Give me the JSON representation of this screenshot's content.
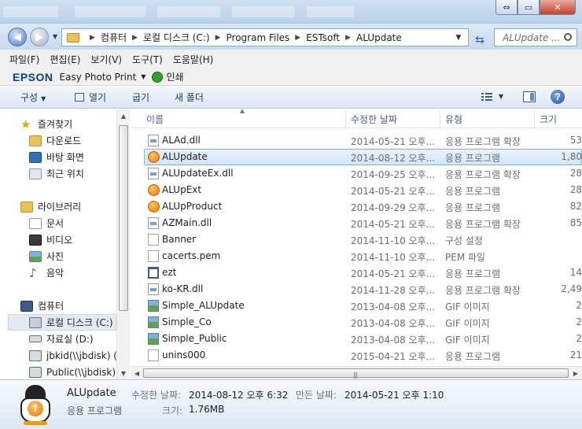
{
  "address": {
    "crumbs": [
      "컴퓨터",
      "로컬 디스크 (C:)",
      "Program Files",
      "ESTsoft",
      "ALUpdate"
    ]
  },
  "search": {
    "placeholder": "ALUpdate ..."
  },
  "menu": [
    "파일(F)",
    "편집(E)",
    "보기(V)",
    "도구(T)",
    "도움말(H)"
  ],
  "epson": {
    "logo": "EPSON",
    "app": "Easy Photo Print",
    "print": "인쇄"
  },
  "command": {
    "organize": "구성",
    "open": "열기",
    "burn": "굽기",
    "new_folder": "새 폴더"
  },
  "nav": {
    "favorites": "즐겨찾기",
    "downloads": "다운로드",
    "desktop": "바탕 화면",
    "recent": "최근 위치",
    "libraries": "라이브러리",
    "documents": "문서",
    "videos": "비디오",
    "pictures": "사진",
    "music": "음악",
    "computer": "컴퓨터",
    "local_disk": "로컬 디스크 (C:)",
    "drive_d": "자료실 (D:)",
    "jbkid": "jbkid(\\\\jbdisk) (",
    "public": "Public(\\\\jbdisk) ("
  },
  "columns": {
    "name": "이름",
    "date": "수정한 날짜",
    "type": "유형",
    "size": "크기"
  },
  "files": [
    {
      "name": "ALAd.dll",
      "date": "2014-05-21 오후...",
      "type": "응용 프로그램 확장",
      "size": "53",
      "icon": "dll"
    },
    {
      "name": "ALUpdate",
      "date": "2014-08-12 오후...",
      "type": "응용 프로그램",
      "size": "1,80",
      "icon": "app",
      "selected": true
    },
    {
      "name": "ALUpdateEx.dll",
      "date": "2014-09-25 오후...",
      "type": "응용 프로그램 확장",
      "size": "28",
      "icon": "dll"
    },
    {
      "name": "ALUpExt",
      "date": "2014-05-21 오후...",
      "type": "응용 프로그램",
      "size": "28",
      "icon": "app"
    },
    {
      "name": "ALUpProduct",
      "date": "2014-09-29 오후...",
      "type": "응용 프로그램",
      "size": "82",
      "icon": "app"
    },
    {
      "name": "AZMain.dll",
      "date": "2014-05-21 오후...",
      "type": "응용 프로그램 확장",
      "size": "85",
      "icon": "dll"
    },
    {
      "name": "Banner",
      "date": "2014-11-10 오후...",
      "type": "구성 설정",
      "size": "",
      "icon": "cfg"
    },
    {
      "name": "cacerts.pem",
      "date": "2014-11-10 오후...",
      "type": "PEM 파일",
      "size": "",
      "icon": "file"
    },
    {
      "name": "ezt",
      "date": "2014-05-21 오후...",
      "type": "응용 프로그램",
      "size": "14",
      "icon": "exe"
    },
    {
      "name": "ko-KR.dll",
      "date": "2014-11-28 오후...",
      "type": "응용 프로그램 확장",
      "size": "2,49",
      "icon": "dll"
    },
    {
      "name": "Simple_ALUpdate",
      "date": "2013-04-08 오후...",
      "type": "GIF 이미지",
      "size": "2",
      "icon": "gif"
    },
    {
      "name": "Simple_Co",
      "date": "2013-04-08 오후...",
      "type": "GIF 이미지",
      "size": "2",
      "icon": "gif"
    },
    {
      "name": "Simple_Public",
      "date": "2013-04-08 오후...",
      "type": "GIF 이미지",
      "size": "2",
      "icon": "gif"
    },
    {
      "name": "unins000",
      "date": "2015-04-21 오후...",
      "type": "응용 프로그램",
      "size": "21",
      "icon": "inst"
    }
  ],
  "details": {
    "name": "ALUpdate",
    "type": "응용 프로그램",
    "modified_label": "수정한 날짜:",
    "modified_value": "2014-08-12 오후 6:32",
    "created_label": "만든 날짜:",
    "created_value": "2014-05-21 오후 1:10",
    "size_label": "크기:",
    "size_value": "1.76MB"
  }
}
